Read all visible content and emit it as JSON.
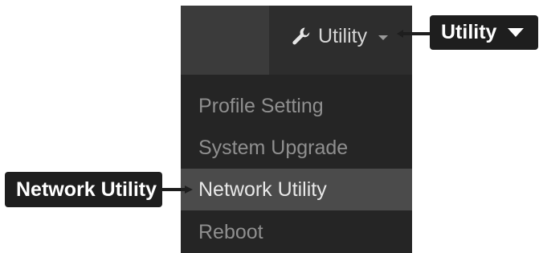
{
  "navbar": {
    "utility_label": "Utility"
  },
  "dropdown": {
    "items": [
      {
        "label": "Profile Setting",
        "active": false
      },
      {
        "label": "System Upgrade",
        "active": false
      },
      {
        "label": "Network Utility",
        "active": true
      },
      {
        "label": "Reboot",
        "active": false
      }
    ]
  },
  "callouts": {
    "utility": "Utility",
    "network_utility": "Network Utility"
  },
  "icons": {
    "utility_toggle": "wrench-icon",
    "dropdown_caret": "chevron-down-icon"
  },
  "colors": {
    "navbar_bg": "#2d2d2d",
    "dropdown_bg": "#252525",
    "active_item_bg": "#4b4b4b",
    "callout_bg": "#1e1e1e"
  }
}
